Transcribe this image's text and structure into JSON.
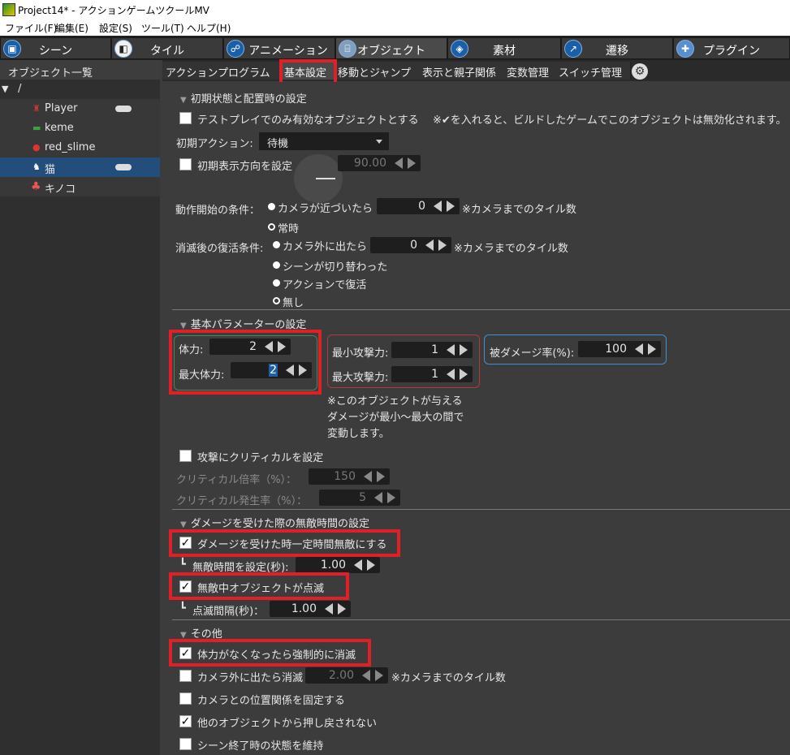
{
  "window": {
    "title": "Project14* - アクションゲームツクールMV"
  },
  "menu": [
    "ファイル(F)",
    "編集(E)",
    "設定(S)",
    "ツール(T)",
    "ヘルプ(H)"
  ],
  "top_tabs": [
    {
      "label": "シーン",
      "icon": "scene-icon"
    },
    {
      "label": "タイル",
      "icon": "tile-icon"
    },
    {
      "label": "アニメーション",
      "icon": "animation-icon"
    },
    {
      "label": "オブジェクト",
      "icon": "object-icon"
    },
    {
      "label": "素材",
      "icon": "material-icon"
    },
    {
      "label": "遷移",
      "icon": "transition-icon"
    },
    {
      "label": "プラグイン",
      "icon": "plugin-icon"
    }
  ],
  "left_panel": {
    "title": "オブジェクト一覧",
    "root": "/",
    "items": [
      {
        "label": "Player",
        "icon": "player-sprite-icon",
        "gamepad": true
      },
      {
        "label": "keme",
        "icon": "keme-sprite-icon",
        "gamepad": false
      },
      {
        "label": "red_slime",
        "icon": "slime-sprite-icon",
        "gamepad": false
      },
      {
        "label": "猫",
        "icon": "cat-sprite-icon",
        "gamepad": true,
        "selected": true
      },
      {
        "label": "キノコ",
        "icon": "mushroom-sprite-icon",
        "gamepad": false
      }
    ]
  },
  "sub_tabs": [
    "アクションプログラム",
    "基本設定",
    "移動とジャンプ",
    "表示と親子関係",
    "変数管理",
    "スイッチ管理"
  ],
  "initial": {
    "section": "初期状態と配置時の設定",
    "test_only_label": "テストプレイでのみ有効なオブジェクトとする",
    "test_only_note": "※✔を入れると、ビルドしたゲームでこのオブジェクトは無効化されます。",
    "initial_action_label": "初期アクション:",
    "initial_action_value": "待機",
    "initial_direction_label": "初期表示方向を設定",
    "initial_direction_value": "90.00",
    "start_cond_label": "動作開始の条件：",
    "start_camera_label": "カメラが近づいたら",
    "start_camera_value": "0",
    "tile_note": "※カメラまでのタイル数",
    "start_always_label": "常時",
    "revive_label": "消滅後の復活条件:",
    "revive_camera_label": "カメラ外に出たら",
    "revive_camera_value": "0",
    "revive_scene_label": "シーンが切り替わった",
    "revive_action_label": "アクションで復活",
    "revive_none_label": "無し"
  },
  "params": {
    "section": "基本パラメーターの設定",
    "hp_label": "体力:",
    "hp_value": "2",
    "max_hp_label": "最大体力:",
    "max_hp_value": "2",
    "min_atk_label": "最小攻撃力:",
    "min_atk_value": "1",
    "max_atk_label": "最大攻撃力:",
    "max_atk_value": "1",
    "dmg_rate_label": "被ダメージ率(%):",
    "dmg_rate_value": "100",
    "note": "※このオブジェクトが与える\nダメージが最小～最大の間で\n変動します。",
    "critical_label": "攻撃にクリティカルを設定",
    "crit_mult_label": "クリティカル倍率（%）：",
    "crit_mult_value": "150",
    "crit_rate_label": "クリティカル発生率（%）：",
    "crit_rate_value": "5"
  },
  "invincible": {
    "section": "ダメージを受けた際の無敵時間の設定",
    "invincible_label": "ダメージを受けた時一定時間無敵にする",
    "inv_time_label": "無敵時間を設定(秒):",
    "inv_time_value": "1.00",
    "blink_label": "無敵中オブジェクトが点滅",
    "blink_interval_label": "点滅間隔(秒)：",
    "blink_interval_value": "1.00"
  },
  "other": {
    "section": "その他",
    "force_disappear_label": "体力がなくなったら強制的に消滅",
    "camera_out_label": "カメラ外に出たら消滅",
    "camera_out_value": "2.00",
    "camera_out_note": "※カメラまでのタイル数",
    "fix_camera_label": "カメラとの位置関係を固定する",
    "no_pushback_label": "他のオブジェクトから押し戻されない",
    "keep_state_label": "シーン終了時の状態を維持"
  },
  "check": "✓",
  "colors": {
    "highlight": "#e01f26",
    "selected_row": "#234d7a",
    "group_green": "#3a8a5c",
    "group_red": "#b23a3a",
    "group_blue": "#3d8fd6"
  }
}
